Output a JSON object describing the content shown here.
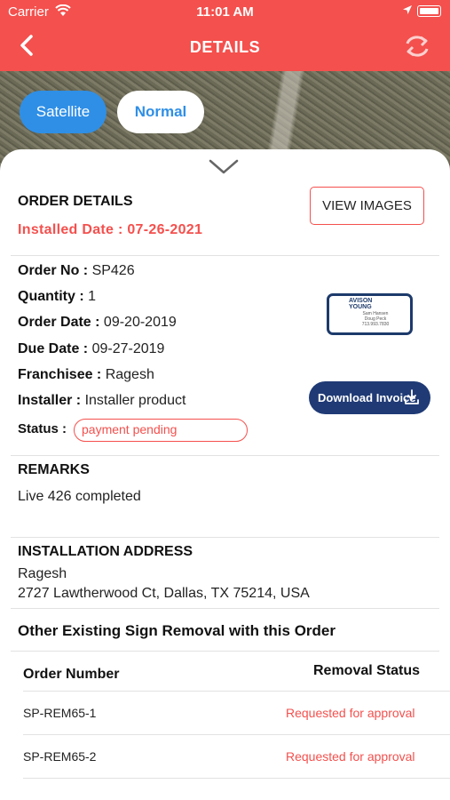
{
  "status_bar": {
    "carrier": "Carrier",
    "time": "11:01 AM"
  },
  "nav": {
    "title": "DETAILS"
  },
  "map": {
    "satellite_label": "Satellite",
    "normal_label": "Normal"
  },
  "order": {
    "section_title": "ORDER DETAILS",
    "installed_date": "Installed Date : 07-26-2021",
    "view_images_label": "VIEW IMAGES",
    "fields": [
      {
        "label": "Order No : ",
        "value": "SP426"
      },
      {
        "label": "Quantity : ",
        "value": "1"
      },
      {
        "label": "Order Date : ",
        "value": "09-20-2019"
      },
      {
        "label": "Due Date : ",
        "value": "09-27-2019"
      },
      {
        "label": "Franchisee : ",
        "value": "Ragesh"
      },
      {
        "label": "Installer : ",
        "value": "Installer product"
      }
    ],
    "status_label": "Status :",
    "status_value": "payment pending",
    "download_label": "Download Invoice",
    "thumbnail": {
      "brand_line1": "AVISON",
      "brand_line2": "YOUNG",
      "names": "Sam Hansen\nDoug Peck\n713.993.7830"
    }
  },
  "remarks": {
    "title": "REMARKS",
    "text": "Live 426 completed"
  },
  "address": {
    "title": "INSTALLATION ADDRESS",
    "name": "Ragesh",
    "line": "2727 Lawtherwood Ct, Dallas, TX 75214, USA"
  },
  "removal": {
    "title": "Other Existing Sign Removal with this Order",
    "col_order": "Order Number",
    "col_status": "Removal Status",
    "rows": [
      {
        "order": "SP-REM65-1",
        "status": "Requested for approval"
      },
      {
        "order": "SP-REM65-2",
        "status": "Requested for approval"
      }
    ]
  },
  "colors": {
    "accent": "#f4504d",
    "blue": "#2f8fe6",
    "navy": "#1f3a75"
  }
}
